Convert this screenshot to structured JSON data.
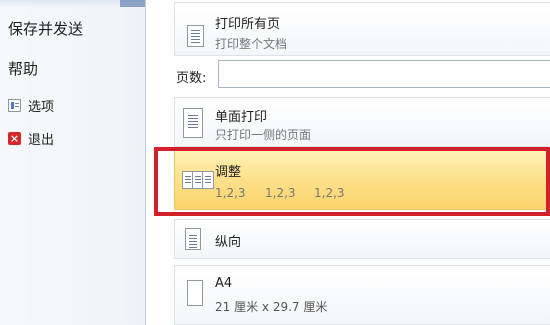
{
  "nav": {
    "save_send": "保存并发送",
    "help": "帮助",
    "options": "选项",
    "exit": "退出",
    "exit_icon_glyph": "×"
  },
  "print_range": {
    "title": "打印所有页",
    "subtitle": "打印整个文档"
  },
  "pages": {
    "label": "页数:",
    "value": ""
  },
  "sides": {
    "title": "单面打印",
    "subtitle": "只打印一侧的页面"
  },
  "collate": {
    "title": "调整",
    "sequence": [
      "1,2,3",
      "1,2,3",
      "1,2,3"
    ],
    "highlight_color": "#fde08a",
    "annotation_color": "#d4202a"
  },
  "orientation": {
    "title": "纵向"
  },
  "paper": {
    "title": "A4",
    "subtitle": "21 厘米 x 29.7 厘米"
  }
}
